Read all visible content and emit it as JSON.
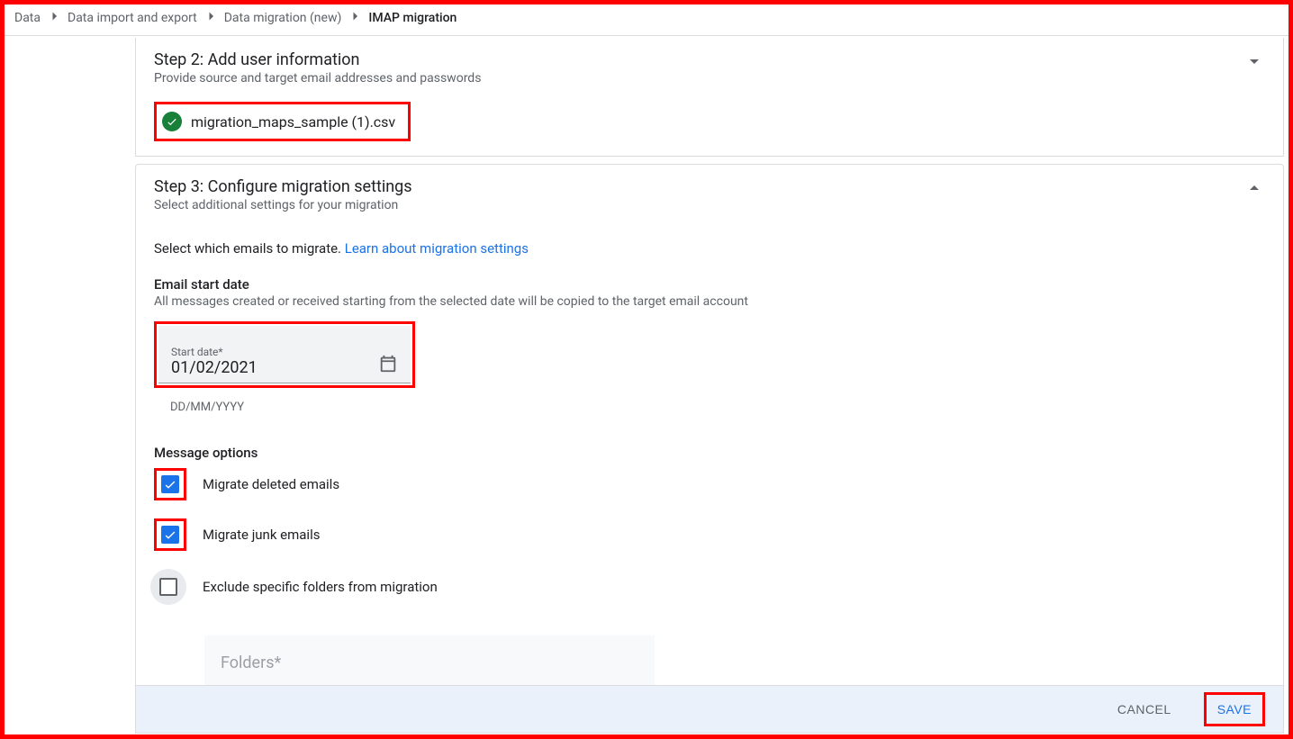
{
  "breadcrumb": {
    "items": [
      "Data",
      "Data import and export",
      "Data migration (new)",
      "IMAP migration"
    ]
  },
  "step2": {
    "title": "Step 2: Add user information",
    "subtitle": "Provide source and target email addresses and passwords",
    "file_name": "migration_maps_sample (1).csv"
  },
  "step3": {
    "title": "Step 3: Configure migration settings",
    "subtitle": "Select additional settings for your migration",
    "lead_text_pre": "Select which emails to migrate. ",
    "lead_link": "Learn about migration settings",
    "email_date_label": "Email start date",
    "email_date_help": "All messages created or received starting from the selected date will be copied to the target email account",
    "start_date_label": "Start date*",
    "start_date_value": "01/02/2021",
    "date_format_hint": "DD/MM/YYYY",
    "msg_opts_label": "Message options",
    "options": {
      "migrate_deleted": "Migrate deleted emails",
      "migrate_junk": "Migrate junk emails",
      "exclude_folders": "Exclude specific folders from migration"
    },
    "folders_placeholder": "Folders*"
  },
  "footer": {
    "cancel": "CANCEL",
    "save": "SAVE"
  }
}
